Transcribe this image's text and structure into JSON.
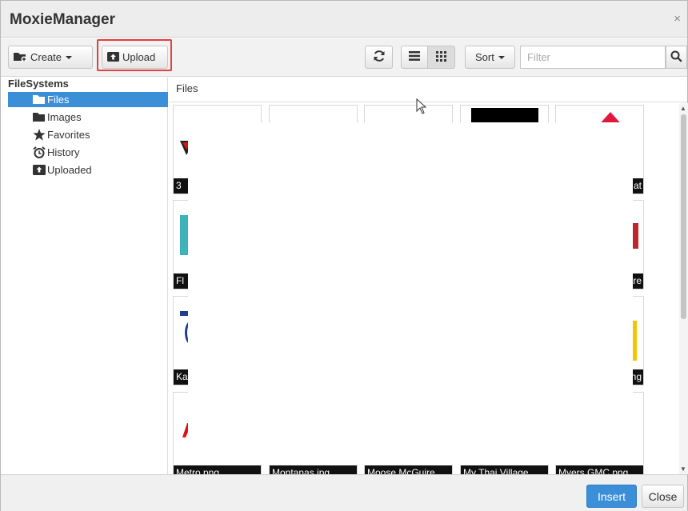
{
  "window": {
    "title": "MoxieManager",
    "close_symbol": "×"
  },
  "toolbar": {
    "create_label": "Create",
    "upload_label": "Upload",
    "sort_label": "Sort",
    "filter_placeholder": "Filter"
  },
  "sidebar": {
    "heading": "FileSystems",
    "items": [
      {
        "label": "Files",
        "icon": "folder-open-icon",
        "active": true
      },
      {
        "label": "Images",
        "icon": "folder-icon",
        "active": false
      },
      {
        "label": "Favorites",
        "icon": "star-icon",
        "active": false
      },
      {
        "label": "History",
        "icon": "alarm-clock-icon",
        "active": false
      },
      {
        "label": "Uploaded",
        "icon": "upload-box-icon",
        "active": false
      }
    ]
  },
  "main": {
    "header": "Files",
    "captions": [
      {
        "text": "3"
      },
      {
        "text": "at"
      },
      {
        "text": "Fl"
      },
      {
        "text": "are"
      },
      {
        "text": "Ka"
      },
      {
        "text": "ng"
      },
      {
        "text": "Metro.png"
      },
      {
        "text": "Montanas.jpg"
      },
      {
        "text": "Moose McGuire"
      },
      {
        "text": "My Thai Village"
      },
      {
        "text": "Myers GMC.png"
      }
    ]
  },
  "footer": {
    "insert_label": "Insert",
    "close_label": "Close"
  },
  "colors": {
    "accent": "#3b8ed8",
    "highlight": "#e04040"
  }
}
